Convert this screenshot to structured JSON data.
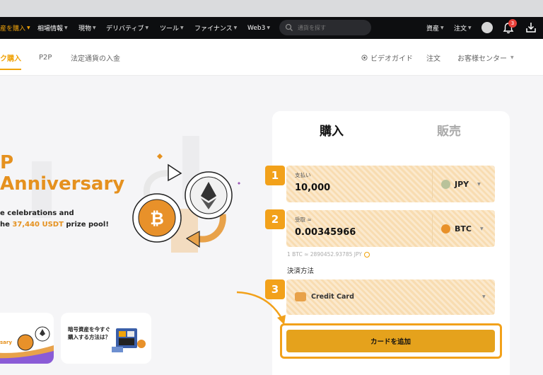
{
  "nav": {
    "items": [
      {
        "label": "産を購入",
        "active": true
      },
      {
        "label": "相場情報"
      },
      {
        "label": "現物"
      },
      {
        "label": "デリバティブ"
      },
      {
        "label": "ツール"
      },
      {
        "label": "ファイナンス"
      },
      {
        "label": "Web3"
      }
    ],
    "search_placeholder": "通貨を探す",
    "assets": "資産",
    "orders": "注文",
    "notification_count": "3"
  },
  "subnav": {
    "quick_buy": "ク購入",
    "p2p": "P2P",
    "fiat_deposit": "法定通貨の入金",
    "video_guide": "ビデオガイド",
    "orders": "注文",
    "customer_center": "お客様センター"
  },
  "hero": {
    "title_partial": "P",
    "title_anniversary": "Anniversary",
    "line1": "e celebrations and",
    "line2_prefix": "he ",
    "line2_highlight": "37,440 USDT",
    "line2_suffix": " prize pool!"
  },
  "cards": {
    "left_text": "sary",
    "right_text": "暗号資産を今すぐ購入する方法は？"
  },
  "trade": {
    "tab_buy": "購入",
    "tab_sell": "販売",
    "pay_label": "支払い",
    "pay_value": "10,000",
    "pay_currency": "JPY",
    "receive_label": "受取 ≈",
    "receive_value": "0.00345966",
    "receive_currency": "BTC",
    "rate": "1 BTC ≈ 2890452.93785 JPY",
    "method_label": "決済方法",
    "method_value": "Credit Card",
    "cta": "カードを追加",
    "steps": [
      "1",
      "2",
      "3"
    ]
  },
  "colors": {
    "accent": "#f2a11a",
    "navbar": "#0d0e10",
    "field_bg": "#fbe9cd"
  }
}
